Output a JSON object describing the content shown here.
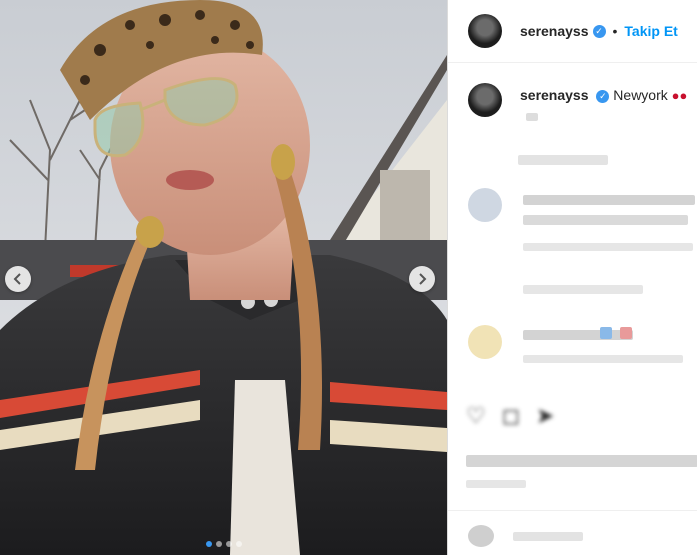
{
  "post": {
    "username": "serenayss",
    "follow_label": "Takip Et",
    "separator": "•",
    "caption_location": "Newyork",
    "cherry_icon": "cherry-emoji",
    "verified_icon": "verified-badge-icon"
  },
  "colors": {
    "accent": "#0095f6",
    "verified": "#3897f0",
    "text": "#262626",
    "muted": "#8e8e8e"
  }
}
